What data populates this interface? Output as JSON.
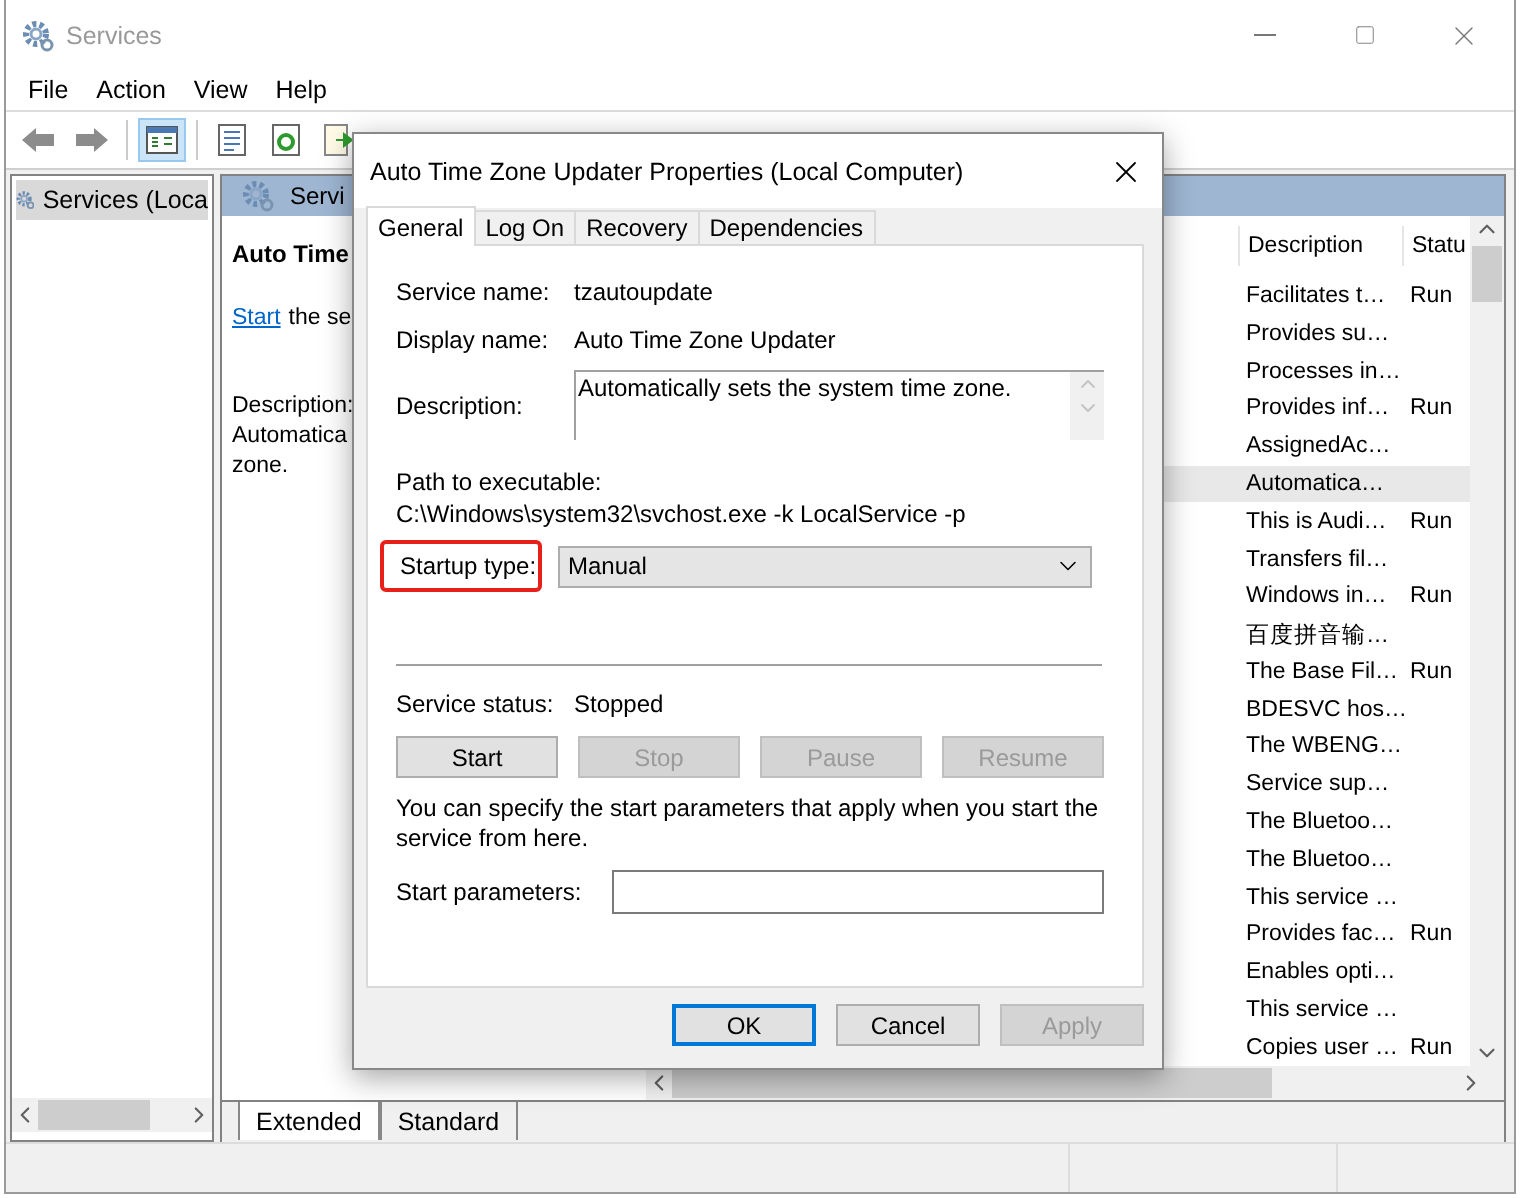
{
  "window": {
    "title": "Services"
  },
  "menu": [
    "File",
    "Action",
    "View",
    "Help"
  ],
  "toolbar": [
    {
      "kind": "back",
      "selected": false
    },
    {
      "kind": "forward",
      "selected": false
    },
    {
      "kind": "tree",
      "selected": true
    },
    {
      "kind": "properties",
      "selected": false
    },
    {
      "kind": "refresh",
      "selected": false
    },
    {
      "kind": "export",
      "selected": false
    }
  ],
  "tree": {
    "items": [
      {
        "label": "Services (Loca",
        "selected": true
      }
    ]
  },
  "panel": {
    "header": "Servi",
    "title": "Auto Time",
    "link": "Start",
    "link_suffix": "the se",
    "description_label": "Description:",
    "description_lines": [
      "Automatica",
      "zone."
    ]
  },
  "list": {
    "columns": [
      "Description",
      "Statu"
    ],
    "rows": [
      {
        "description": "Facilitates t…",
        "status": "Run",
        "selected": false
      },
      {
        "description": "Provides su…",
        "selected": false
      },
      {
        "description": "Processes in…",
        "selected": false
      },
      {
        "description": "Provides inf…",
        "status": "Run",
        "selected": false
      },
      {
        "description": "AssignedAc…",
        "selected": false
      },
      {
        "description": "Automatica…",
        "selected": true
      },
      {
        "description": "This is Audi…",
        "status": "Run",
        "selected": false
      },
      {
        "description": "Transfers fil…",
        "selected": false
      },
      {
        "description": "Windows in…",
        "status": "Run",
        "selected": false
      },
      {
        "description": "百度拼音输…",
        "selected": false
      },
      {
        "description": "The Base Fil…",
        "status": "Run",
        "selected": false
      },
      {
        "description": "BDESVC hos…",
        "selected": false
      },
      {
        "description": "The WBENG…",
        "selected": false
      },
      {
        "description": "Service sup…",
        "selected": false
      },
      {
        "description": "The Bluetoo…",
        "selected": false
      },
      {
        "description": "The Bluetoo…",
        "selected": false
      },
      {
        "description": "This service …",
        "selected": false
      },
      {
        "description": "Provides fac…",
        "status": "Run",
        "selected": false
      },
      {
        "description": "Enables opti…",
        "selected": false
      },
      {
        "description": "This service …",
        "selected": false
      },
      {
        "description": "Copies user …",
        "status": "Run",
        "selected": false
      }
    ]
  },
  "view_tabs": [
    {
      "label": "Extended",
      "selected": true
    },
    {
      "label": "Standard",
      "selected": false
    }
  ],
  "dialog": {
    "title": "Auto Time Zone Updater Properties (Local Computer)",
    "tabs": [
      {
        "label": "General",
        "selected": true
      },
      {
        "label": "Log On",
        "selected": false
      },
      {
        "label": "Recovery",
        "selected": false
      },
      {
        "label": "Dependencies",
        "selected": false
      }
    ],
    "service_name": {
      "label": "Service name:",
      "value": "tzautoupdate"
    },
    "display_name": {
      "label": "Display name:",
      "value": "Auto Time Zone Updater"
    },
    "description": {
      "label": "Description:",
      "value": "Automatically sets the system time zone."
    },
    "path": {
      "label": "Path to executable:",
      "value": "C:\\Windows\\system32\\svchost.exe -k LocalService -p"
    },
    "startup_type": {
      "label": "Startup type:",
      "value": "Manual",
      "highlighted": true
    },
    "service_status": {
      "label": "Service status:",
      "value": "Stopped"
    },
    "control_buttons": [
      {
        "label": "Start",
        "disabled": false
      },
      {
        "label": "Stop",
        "disabled": true
      },
      {
        "label": "Pause",
        "disabled": true
      },
      {
        "label": "Resume",
        "disabled": true
      }
    ],
    "note": "You can specify the start parameters that apply when you start the service from here.",
    "start_parameters": {
      "label": "Start parameters:"
    },
    "footer_buttons": [
      {
        "label": "OK",
        "disabled": false,
        "default": true
      },
      {
        "label": "Cancel",
        "disabled": false,
        "default": false
      },
      {
        "label": "Apply",
        "disabled": true,
        "default": false
      }
    ]
  }
}
